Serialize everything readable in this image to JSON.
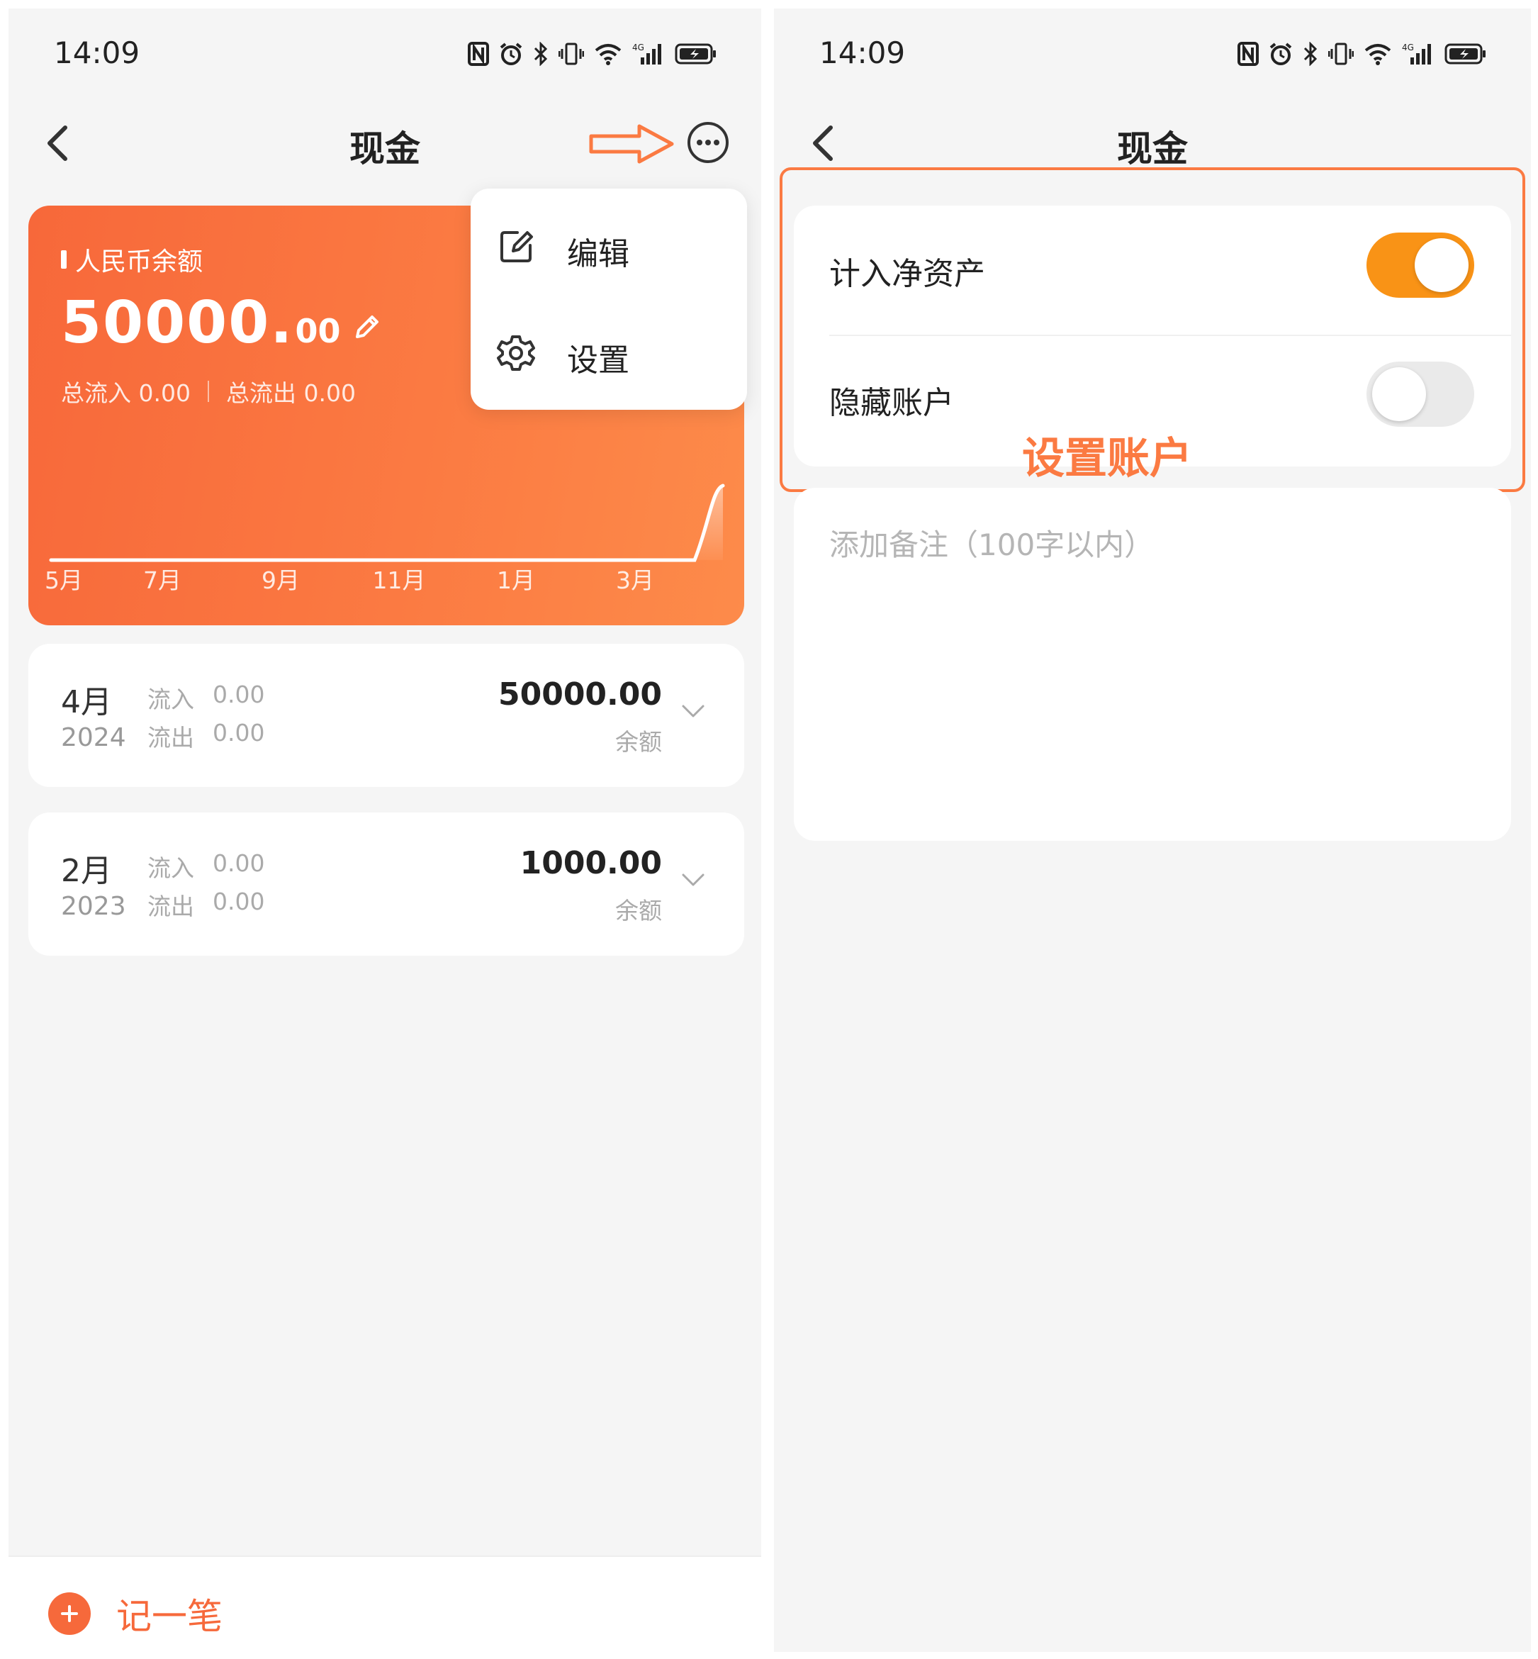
{
  "left": {
    "status_time": "14:09",
    "nav_title": "现金",
    "card": {
      "label": "人民币余额",
      "amount_int": "50000.",
      "amount_dec": "00",
      "total_in": "总流入 0.00",
      "total_out": "总流出 0.00",
      "chart_ticks": [
        "5月",
        "7月",
        "9月",
        "11月",
        "1月",
        "3月"
      ]
    },
    "menu": [
      {
        "label": "编辑",
        "icon": "edit-icon"
      },
      {
        "label": "设置",
        "icon": "gear-icon"
      }
    ],
    "months": [
      {
        "month": "4月",
        "year": "2024",
        "in_label": "流入",
        "in_value": "0.00",
        "out_label": "流出",
        "out_value": "0.00",
        "balance": "50000.00",
        "balance_label": "余额"
      },
      {
        "month": "2月",
        "year": "2023",
        "in_label": "流入",
        "in_value": "0.00",
        "out_label": "流出",
        "out_value": "0.00",
        "balance": "1000.00",
        "balance_label": "余额"
      }
    ],
    "add_label": "记一笔"
  },
  "right": {
    "status_time": "14:09",
    "nav_title": "现金",
    "settings": [
      {
        "label": "计入净资产",
        "enabled": true
      },
      {
        "label": "隐藏账户",
        "enabled": false
      }
    ],
    "annotation": "设置账户",
    "note_placeholder": "添加备注（100字以内）"
  },
  "colors": {
    "accent": "#f6693b",
    "toggle_on": "#f99316",
    "annotation": "#fb7a42"
  }
}
